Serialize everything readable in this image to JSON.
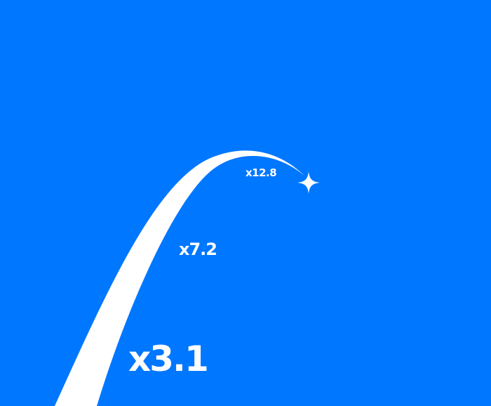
{
  "multipliers": {
    "large": "x3.1",
    "medium": "x7.2",
    "small": "x12.8"
  },
  "colors": {
    "background": "#0077FF",
    "foreground": "#FFFFFF"
  },
  "icons": {
    "trajectory": "rising-arc-trail",
    "endpoint": "four-point-sparkle-icon"
  }
}
